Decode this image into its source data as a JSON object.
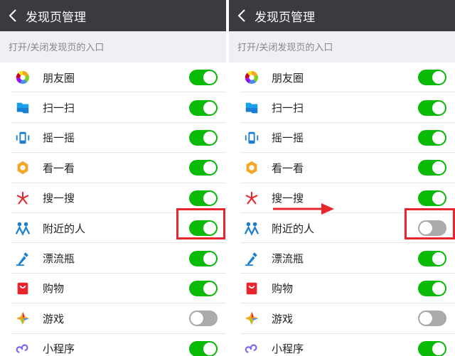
{
  "left": {
    "title": "发现页管理",
    "section": "打开/关闭发现页的入口",
    "items": [
      {
        "label": "朋友圈",
        "on": true
      },
      {
        "label": "扫一扫",
        "on": true
      },
      {
        "label": "摇一摇",
        "on": true
      },
      {
        "label": "看一看",
        "on": true
      },
      {
        "label": "搜一搜",
        "on": true
      },
      {
        "label": "附近的人",
        "on": true
      },
      {
        "label": "漂流瓶",
        "on": true
      },
      {
        "label": "购物",
        "on": true
      },
      {
        "label": "游戏",
        "on": false
      },
      {
        "label": "小程序",
        "on": true
      }
    ]
  },
  "right": {
    "title": "发现页管理",
    "section": "打开/关闭发现页的入口",
    "items": [
      {
        "label": "朋友圈",
        "on": true
      },
      {
        "label": "扫一扫",
        "on": true
      },
      {
        "label": "摇一摇",
        "on": true
      },
      {
        "label": "看一看",
        "on": true
      },
      {
        "label": "搜一搜",
        "on": true
      },
      {
        "label": "附近的人",
        "on": false
      },
      {
        "label": "漂流瓶",
        "on": true
      },
      {
        "label": "购物",
        "on": true
      },
      {
        "label": "游戏",
        "on": false
      },
      {
        "label": "小程序",
        "on": true
      }
    ]
  },
  "icons": [
    "moments-icon",
    "scan-icon",
    "shake-icon",
    "top-stories-icon",
    "search-icon",
    "people-nearby-icon",
    "drift-bottle-icon",
    "shopping-icon",
    "games-icon",
    "mini-programs-icon"
  ],
  "colors": {
    "header": "#3a3a3f",
    "toggle_on": "#09bb07",
    "highlight": "#e8242c"
  }
}
